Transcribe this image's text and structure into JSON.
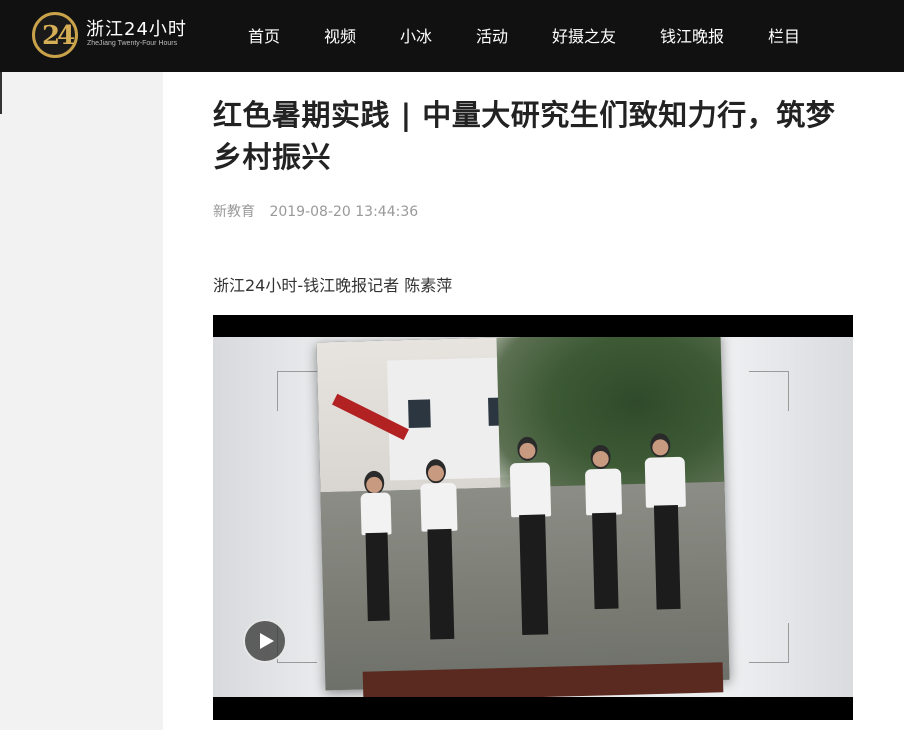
{
  "header": {
    "logo": {
      "mark": "24",
      "title": "浙江24小时",
      "subtitle": "ZheJiang Twenty-Four Hours"
    },
    "nav": [
      {
        "label": "首页"
      },
      {
        "label": "视频"
      },
      {
        "label": "小冰"
      },
      {
        "label": "活动"
      },
      {
        "label": "好摄之友"
      },
      {
        "label": "钱江晚报"
      },
      {
        "label": "栏目"
      }
    ]
  },
  "article": {
    "title": "红色暑期实践 | 中量大研究生们致知力行，筑梦乡村振兴",
    "category": "新教育",
    "timestamp": "2019-08-20 13:44:36",
    "byline": "浙江24小时-钱江晚报记者 陈素萍"
  },
  "video": {
    "play_icon": "play-icon",
    "state": "paused"
  },
  "colors": {
    "header_bg": "#111111",
    "logo_gold": "#c9a24a",
    "left_panel_bg": "#f2f2f2",
    "meta_gray": "#999999"
  }
}
